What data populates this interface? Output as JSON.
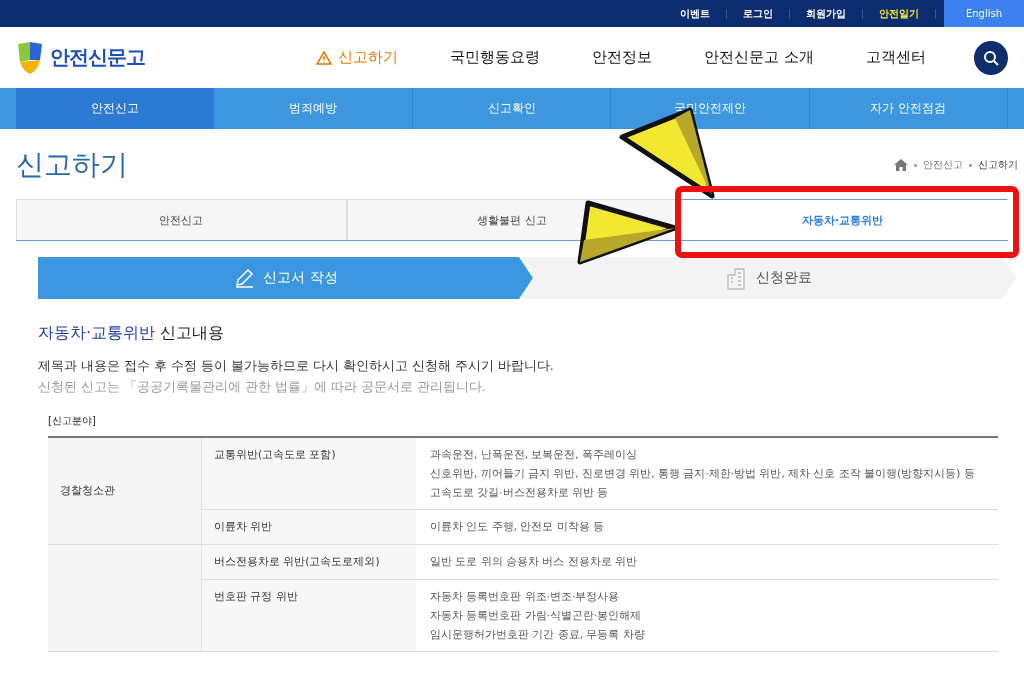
{
  "top_links": [
    {
      "label": "이벤트",
      "highlight": false
    },
    {
      "label": "로그인",
      "highlight": false
    },
    {
      "label": "회원가입",
      "highlight": false
    },
    {
      "label": "안전일기",
      "highlight": true
    }
  ],
  "language_button": "English",
  "logo": "안전신문고",
  "main_nav": [
    {
      "label": "신고하기",
      "selected": true
    },
    {
      "label": "국민행동요령",
      "selected": false
    },
    {
      "label": "안전정보",
      "selected": false
    },
    {
      "label": "안전신문고 소개",
      "selected": false
    },
    {
      "label": "고객센터",
      "selected": false
    }
  ],
  "sub_nav": [
    {
      "label": "안전신고",
      "selected": true
    },
    {
      "label": "범죄예방",
      "selected": false
    },
    {
      "label": "신고확인",
      "selected": false
    },
    {
      "label": "국민안전제안",
      "selected": false
    },
    {
      "label": "자가 안전점검",
      "selected": false
    }
  ],
  "page_title": "신고하기",
  "breadcrumb": [
    "안전신고",
    "신고하기"
  ],
  "tabs": [
    {
      "label": "안전신고",
      "selected": false
    },
    {
      "label": "생활불편 신고",
      "selected": false
    },
    {
      "label": "자동차·교통위반",
      "selected": true
    }
  ],
  "steps": [
    {
      "label": "신고서 작성",
      "selected": true
    },
    {
      "label": "신청완료",
      "selected": false
    }
  ],
  "section_title": "**자동차·교통위반** 신고내용",
  "notice": "제목과 내용은 접수 후 수정 등이 불가능하므로 다시 확인하시고 신청해 주시기 바랍니다.",
  "sub_notice": "신청된 신고는 「공공기록물관리에 관한 법률」에 따라 공문서로 관리됩니다.",
  "table_caption": "[신고분야]",
  "groups": [
    {
      "label": "경찰청소관",
      "rows": [
        {
          "field": "교통위반(고속도로 포함)",
          "examples": [
            "과속운전, 난폭운전, 보복운전, 폭주레이싱",
            "신호위반, 끼어들기 금지 위반, 진로변경 위반, 통행 금지·제한·방법 위반, 제차 신호 조작 불이행(방향지시등) 등",
            "고속도로 갓길·버스전용차로 위반 등"
          ]
        },
        {
          "field": "이륜차 위반",
          "examples": [
            "이륜차 인도 주행, 안전모 미착용 등"
          ]
        }
      ]
    },
    {
      "rows": [
        {
          "field": "버스전용차로 위반(고속도로제외)",
          "examples": [
            "일반 도로 위의 승용차 버스 전용차로 위반"
          ]
        },
        {
          "field": "번호판 규정 위반",
          "examples": [
            "자동차 등록번호판 위조·변조·부정사용",
            "자동차 등록번호판 가림·식별곤란·봉인해제",
            "임시운행허가번호판 기간 종료, 무등록 차량"
          ]
        }
      ]
    }
  ]
}
